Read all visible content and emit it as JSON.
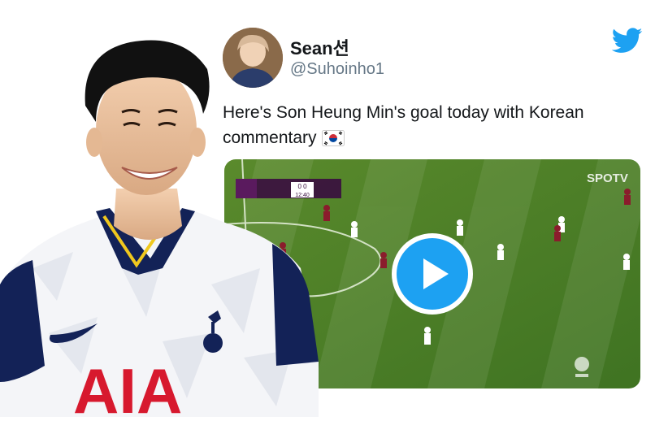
{
  "tweet": {
    "author_name": "Sean션",
    "author_handle": "@Suhoinho1",
    "text": "Here's Son Heung Min's goal today with Korean commentary",
    "flag_icon": "south-korea-flag-icon",
    "brand_icon": "twitter-bird-icon",
    "accent_color": "#1da1f2"
  },
  "video": {
    "play_icon": "play-icon",
    "scoreboard": {
      "score": "0 0",
      "clock": "12:40"
    },
    "watermark": "SPOTV",
    "league_logo": "premier-league-logo"
  },
  "player_photo": {
    "shirt_sponsor": "AIA",
    "shirt_color": "#f4f5f8",
    "trim_color": "#132257"
  }
}
